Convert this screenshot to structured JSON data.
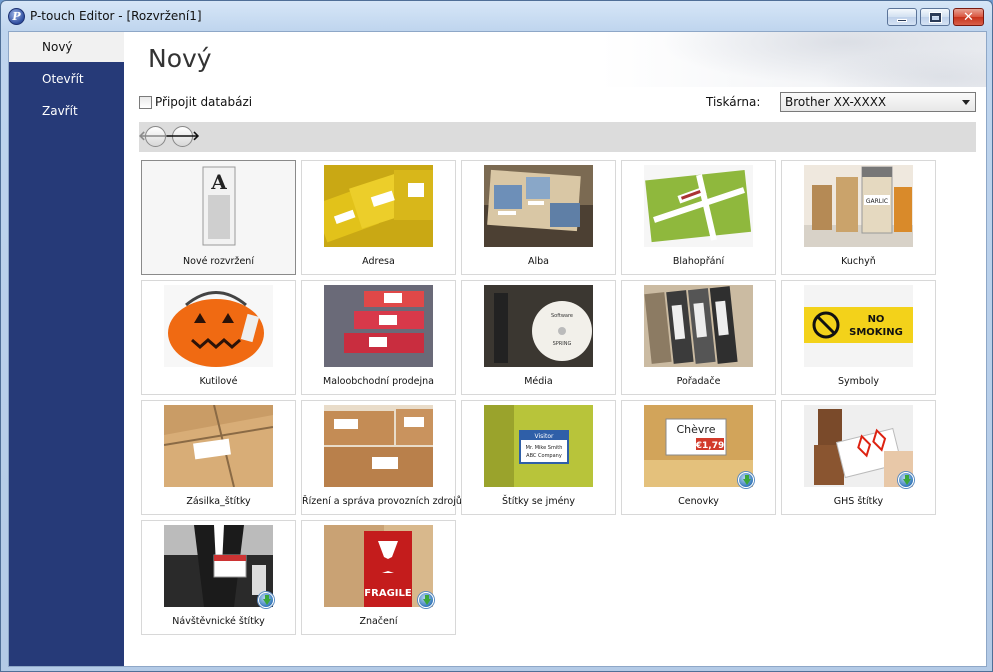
{
  "window": {
    "title": "P-touch Editor - [Rozvržení1]",
    "close_symbol": "✕"
  },
  "sidebar": {
    "items": [
      {
        "label": "Nový",
        "active": true
      },
      {
        "label": "Otevřít",
        "active": false
      },
      {
        "label": "Zavřít",
        "active": false
      }
    ]
  },
  "main": {
    "title": "Nový",
    "connect_db_label": "Připojit databázi",
    "connect_db_checked": false,
    "printer_label": "Tiskárna:",
    "printer_value": "Brother XX-XXXX",
    "nav_back_symbol": "🡐",
    "nav_forward_symbol": "🡒"
  },
  "templates": [
    {
      "label": "Nové rozvržení",
      "thumb": "new-layout",
      "download": false,
      "selected": true
    },
    {
      "label": "Adresa",
      "thumb": "address",
      "download": false
    },
    {
      "label": "Alba",
      "thumb": "albums",
      "download": false
    },
    {
      "label": "Blahopřání",
      "thumb": "greeting",
      "download": false
    },
    {
      "label": "Kuchyň",
      "thumb": "kitchen",
      "download": false
    },
    {
      "label": "Kutilové",
      "thumb": "diy",
      "download": false
    },
    {
      "label": "Maloobchodní prodejna",
      "thumb": "retail",
      "download": false
    },
    {
      "label": "Média",
      "thumb": "media",
      "download": false
    },
    {
      "label": "Pořadače",
      "thumb": "binders",
      "download": false
    },
    {
      "label": "Symboly",
      "thumb": "symbols",
      "download": false
    },
    {
      "label": "Zásilka_štítky",
      "thumb": "shipping",
      "download": false
    },
    {
      "label": "Řízení a správa provozních zdrojů",
      "thumb": "asset",
      "download": false
    },
    {
      "label": "Štítky se jmény",
      "thumb": "name-tags",
      "download": false
    },
    {
      "label": "Cenovky",
      "thumb": "price-tags",
      "download": true
    },
    {
      "label": "GHS štítky",
      "thumb": "ghs",
      "download": true
    },
    {
      "label": "Návštěvnické štítky",
      "thumb": "visitor",
      "download": true
    },
    {
      "label": "Značení",
      "thumb": "signage",
      "download": true
    }
  ],
  "thumb_text": {
    "new-layout": "A",
    "symbols": [
      "NO",
      "SMOKING"
    ],
    "name-tags": [
      "Visitor",
      "Mr. Mike Smith",
      "ABC Company"
    ],
    "price-tags": [
      "Chèvre",
      "€1,79"
    ],
    "signage": "FRAGILE",
    "media": [
      "Software",
      "SPRING"
    ],
    "kitchen": "GARLIC"
  }
}
